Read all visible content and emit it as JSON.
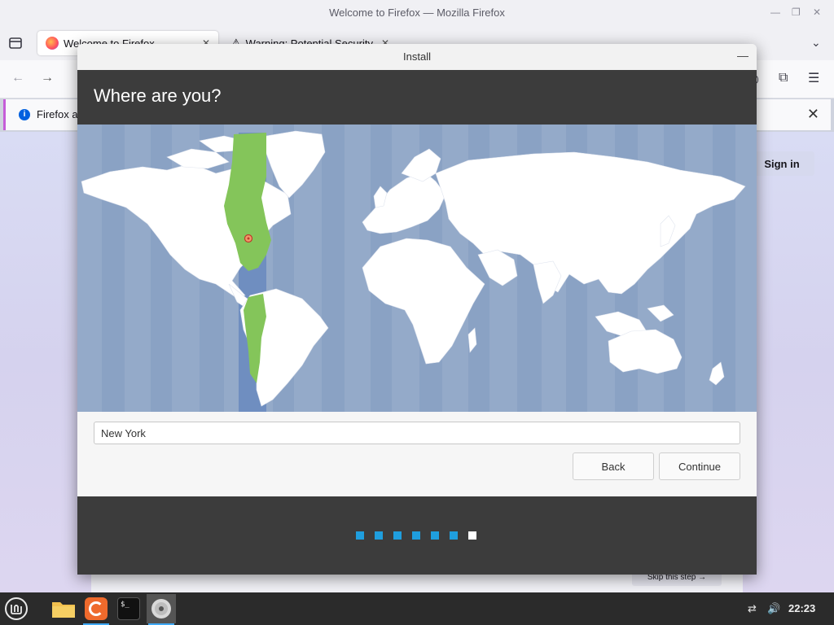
{
  "firefox": {
    "window_title": "Welcome to Firefox — Mozilla Firefox",
    "tabs": [
      {
        "label": "Welcome to Firefox"
      },
      {
        "label": "Warning: Potential Security"
      }
    ],
    "infobar_text": "Firefox a",
    "signin_label": "Sign in",
    "skip_label": "Skip this step →"
  },
  "dialog": {
    "title": "Install",
    "heading": "Where are you?",
    "location_value": "New York",
    "back_label": "Back",
    "continue_label": "Continue",
    "progress": {
      "total_steps": 7,
      "current_step": 7
    }
  },
  "taskbar": {
    "clock": "22:23"
  },
  "colors": {
    "map_ocean": "#94aac9",
    "timezone_band": "#6f8ec0",
    "timezone_highlight": "#84c55a",
    "dialog_dark": "#3c3c3c",
    "progress_dot": "#1f9ede"
  }
}
